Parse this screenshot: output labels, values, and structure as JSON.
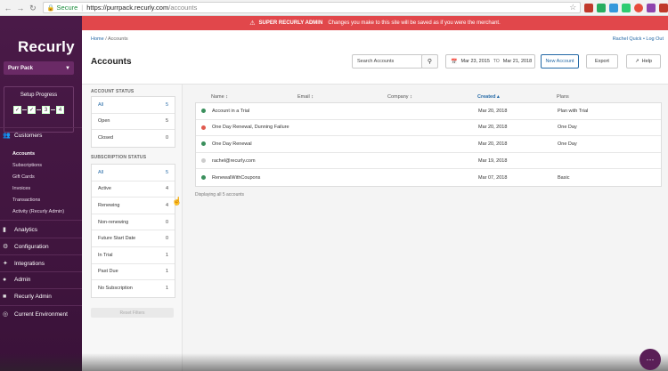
{
  "browser": {
    "secure_label": "Secure",
    "url_host": "https://purrpack.recurly.com",
    "url_path": "/accounts"
  },
  "banner": {
    "title": "SUPER RECURLY ADMIN",
    "message": "Changes you make to this site will be saved as if you were the merchant."
  },
  "sidebar": {
    "logo": "Recurly",
    "site_name": "Purr Pack",
    "setup_title": "Setup Progress",
    "steps": [
      "✓",
      "✓",
      "3",
      "4"
    ],
    "customers_label": "Customers",
    "customer_items": [
      "Accounts",
      "Subscriptions",
      "Gift Cards",
      "Invoices",
      "Transactions",
      "Activity (Recurly Admin)"
    ],
    "sections": [
      "Analytics",
      "Configuration",
      "Integrations",
      "Admin",
      "Recurly Admin",
      "Current Environment"
    ]
  },
  "header": {
    "breadcrumb_home": "Home",
    "breadcrumb_current": "Accounts",
    "user_name": "Rachel Quick",
    "logout": "Log Out",
    "title": "Accounts",
    "search_placeholder": "Search Accounts",
    "date_from": "Mar 23, 2015",
    "date_to_label": "TO",
    "date_to": "Mar 21, 2018",
    "new_account": "New Account",
    "export": "Export",
    "help": "Help"
  },
  "filters": {
    "account_status_title": "ACCOUNT STATUS",
    "account_status": [
      {
        "label": "All",
        "count": "5"
      },
      {
        "label": "Open",
        "count": "5"
      },
      {
        "label": "Closed",
        "count": "0"
      }
    ],
    "subscription_status_title": "SUBSCRIPTION STATUS",
    "subscription_status": [
      {
        "label": "All",
        "count": "5"
      },
      {
        "label": "Active",
        "count": "4"
      },
      {
        "label": "Renewing",
        "count": "4"
      },
      {
        "label": "Non-renewing",
        "count": "0"
      },
      {
        "label": "Future Start Date",
        "count": "0"
      },
      {
        "label": "In Trial",
        "count": "1"
      },
      {
        "label": "Past Due",
        "count": "1"
      },
      {
        "label": "No Subscription",
        "count": "1"
      }
    ],
    "reset_label": "Reset Filters"
  },
  "table": {
    "headers": {
      "name": "Name ↕",
      "email": "Email ↕",
      "company": "Company ↕",
      "created": "Created ▴",
      "plans": "Plans"
    },
    "rows": [
      {
        "name": "Account in a Trial",
        "email": "",
        "company": "",
        "created": "Mar 20, 2018",
        "plans": "Plan with Trial",
        "status_color": "#3a8f5c"
      },
      {
        "name": "One Day Renewal, Dunning Failure",
        "email": "",
        "company": "",
        "created": "Mar 20, 2018",
        "plans": "One Day",
        "status_color": "#e05a4f"
      },
      {
        "name": "One Day Renewal",
        "email": "",
        "company": "",
        "created": "Mar 20, 2018",
        "plans": "One Day",
        "status_color": "#3a8f5c"
      },
      {
        "name": "rachel@recurly.com",
        "email": "",
        "company": "",
        "created": "Mar 19, 2018",
        "plans": "",
        "status_color": "#cccccc"
      },
      {
        "name": "RenewalWithCoupons",
        "email": "",
        "company": "",
        "created": "Mar 07, 2018",
        "plans": "Basic",
        "status_color": "#3a8f5c"
      }
    ],
    "display_count": "Displaying all 5 accounts"
  }
}
